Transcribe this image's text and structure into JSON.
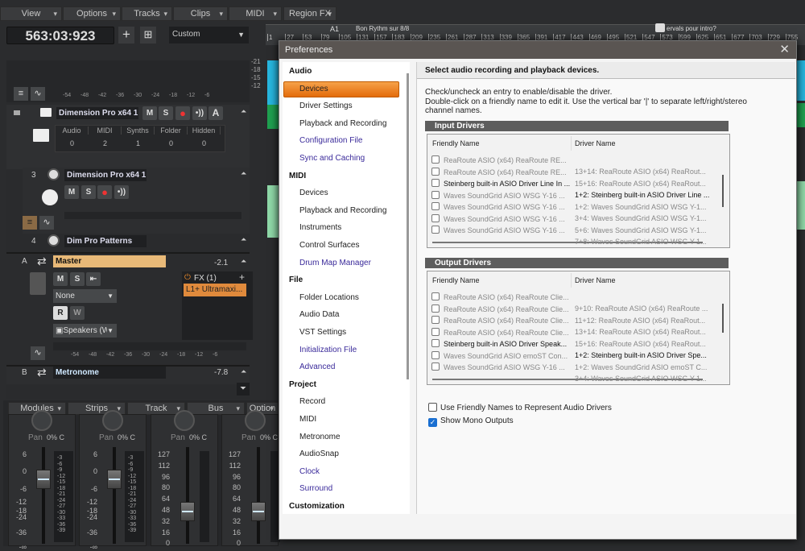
{
  "menus": [
    "View",
    "Options",
    "Tracks",
    "Clips",
    "MIDI",
    "Region FX"
  ],
  "transport": {
    "time": "563:03:923",
    "preset": "Custom"
  },
  "ruler": {
    "markers": [
      "A1",
      "Bon Rythm sur 8/8",
      "ervals pour intro?"
    ],
    "ticks": [
      "1",
      "27",
      "53",
      "79",
      "105",
      "131",
      "157",
      "183",
      "209",
      "235",
      "261",
      "287",
      "313",
      "339",
      "365",
      "391",
      "417",
      "443",
      "469",
      "495",
      "521",
      "547",
      "573",
      "599",
      "625",
      "651",
      "677",
      "703",
      "729",
      "755"
    ]
  },
  "meter_scale": [
    "-54",
    "-48",
    "-42",
    "-36",
    "-30",
    "-24",
    "-18",
    "-12",
    "-6"
  ],
  "vert_scale": [
    "-21",
    "-18",
    "-15",
    "-12"
  ],
  "tracks": {
    "folder": {
      "name": "Dimension Pro x64 1",
      "stats_headers": [
        "Audio",
        "MIDI",
        "Synths",
        "Folder",
        "Hidden"
      ],
      "stats_values": [
        "0",
        "2",
        "1",
        "0",
        "0"
      ]
    },
    "t3": {
      "num": "3",
      "name": "Dimension Pro x64 1"
    },
    "t4": {
      "num": "4",
      "name": "Dim Pro Patterns"
    },
    "master": {
      "letter": "A",
      "name": "Master",
      "value": "-2.1",
      "input": "None",
      "output": "Speakers (W",
      "fx_label": "FX (1)",
      "fx_plugin": "L1+  Ultramaxi..."
    },
    "metronome": {
      "letter": "B",
      "name": "Metronome",
      "value": "-7.8"
    },
    "btn": {
      "m": "M",
      "s": "S",
      "a": "A",
      "r": "R",
      "w": "W"
    }
  },
  "mixer": {
    "menus": [
      "Modules",
      "Strips",
      "Track",
      "Bus",
      "Option"
    ],
    "pan_label": "Pan",
    "pan_value": "0% C",
    "db_scale": [
      "6",
      "0",
      "-6",
      "-12",
      "-18",
      "-24",
      "-36",
      "-∞"
    ],
    "meter_scale": [
      "-3",
      "-6",
      "-9",
      "-12",
      "-15",
      "-18",
      "-21",
      "-24",
      "-27",
      "-30",
      "-33",
      "-36",
      "-39"
    ],
    "midi_scale": [
      "127",
      "112",
      "96",
      "80",
      "64",
      "48",
      "32",
      "16",
      "0"
    ]
  },
  "dialog": {
    "title": "Preferences",
    "nav": [
      {
        "type": "h",
        "label": "Audio"
      },
      {
        "type": "i",
        "label": "Devices",
        "selected": true
      },
      {
        "type": "i",
        "label": "Driver Settings"
      },
      {
        "type": "i",
        "label": "Playback and Recording"
      },
      {
        "type": "l",
        "label": "Configuration File"
      },
      {
        "type": "l",
        "label": "Sync and Caching"
      },
      {
        "type": "h",
        "label": "MIDI"
      },
      {
        "type": "i",
        "label": "Devices"
      },
      {
        "type": "i",
        "label": "Playback and Recording"
      },
      {
        "type": "i",
        "label": "Instruments"
      },
      {
        "type": "i",
        "label": "Control Surfaces"
      },
      {
        "type": "l",
        "label": "Drum Map Manager"
      },
      {
        "type": "h",
        "label": "File"
      },
      {
        "type": "i",
        "label": "Folder Locations"
      },
      {
        "type": "i",
        "label": "Audio Data"
      },
      {
        "type": "i",
        "label": "VST Settings"
      },
      {
        "type": "l",
        "label": "Initialization File"
      },
      {
        "type": "l",
        "label": "Advanced"
      },
      {
        "type": "h",
        "label": "Project"
      },
      {
        "type": "i",
        "label": "Record"
      },
      {
        "type": "i",
        "label": "MIDI"
      },
      {
        "type": "i",
        "label": "Metronome"
      },
      {
        "type": "i",
        "label": "AudioSnap"
      },
      {
        "type": "l",
        "label": "Clock"
      },
      {
        "type": "l",
        "label": "Surround"
      },
      {
        "type": "h",
        "label": "Customization"
      }
    ],
    "heading": "Select audio recording and playback devices.",
    "instructions": [
      "Check/uncheck an entry to enable/disable the driver.",
      "Double-click on a friendly name to edit it. Use the vertical bar '|' to separate left/right/stereo",
      "channel names."
    ],
    "input": {
      "title": "Input Drivers",
      "col1": "Friendly Name",
      "col2": "Driver Name",
      "rows": [
        {
          "friendly": "ReaRoute ASIO (x64) ReaRoute RE...",
          "driver": "13+14: ReaRoute ASIO (x64) ReaRout...",
          "enabled": false
        },
        {
          "friendly": "ReaRoute ASIO (x64) ReaRoute RE...",
          "driver": "15+16: ReaRoute ASIO (x64) ReaRout...",
          "enabled": false
        },
        {
          "friendly": "Steinberg built-in ASIO Driver Line In ...",
          "driver": "1+2: Steinberg built-in ASIO Driver Line ...",
          "enabled": true
        },
        {
          "friendly": "Waves SoundGrid ASIO WSG Y-16 ...",
          "driver": "1+2: Waves SoundGrid ASIO WSG Y-1...",
          "enabled": false
        },
        {
          "friendly": "Waves SoundGrid ASIO WSG Y-16 ...",
          "driver": "3+4: Waves SoundGrid ASIO WSG Y-1...",
          "enabled": false
        },
        {
          "friendly": "Waves SoundGrid ASIO WSG Y-16 ...",
          "driver": "5+6: Waves SoundGrid ASIO WSG Y-1...",
          "enabled": false
        },
        {
          "friendly": "Waves SoundGrid ASIO WSG Y-16 ...",
          "driver": "7+8: Waves SoundGrid ASIO WSG Y-1...",
          "enabled": false
        }
      ]
    },
    "output": {
      "title": "Output Drivers",
      "col1": "Friendly Name",
      "col2": "Driver Name",
      "rows": [
        {
          "friendly": "ReaRoute ASIO (x64) ReaRoute Clie...",
          "driver": "9+10: ReaRoute ASIO (x64) ReaRoute ...",
          "enabled": false
        },
        {
          "friendly": "ReaRoute ASIO (x64) ReaRoute Clie...",
          "driver": "11+12: ReaRoute ASIO (x64) ReaRout...",
          "enabled": false
        },
        {
          "friendly": "ReaRoute ASIO (x64) ReaRoute Clie...",
          "driver": "13+14: ReaRoute ASIO (x64) ReaRout...",
          "enabled": false
        },
        {
          "friendly": "ReaRoute ASIO (x64) ReaRoute Clie...",
          "driver": "15+16: ReaRoute ASIO (x64) ReaRout...",
          "enabled": false
        },
        {
          "friendly": "Steinberg built-in ASIO Driver Speak...",
          "driver": "1+2: Steinberg built-in ASIO Driver Spe...",
          "enabled": true
        },
        {
          "friendly": "Waves SoundGrid ASIO emoST Con...",
          "driver": "1+2: Waves SoundGrid ASIO emoST C...",
          "enabled": false
        },
        {
          "friendly": "Waves SoundGrid ASIO WSG Y-16 ...",
          "driver": "3+4: Waves SoundGrid ASIO WSG Y-1...",
          "enabled": false
        }
      ]
    },
    "options": [
      {
        "label": "Use Friendly Names to Represent Audio Drivers",
        "checked": false
      },
      {
        "label": "Show Mono Outputs",
        "checked": true
      }
    ]
  },
  "colors": {
    "accent": "#e97a1c",
    "master_name": "#e8b978",
    "link": "#3a2a9a",
    "wave_blue": "#27b6de",
    "wave_green": "#1fc46a"
  }
}
